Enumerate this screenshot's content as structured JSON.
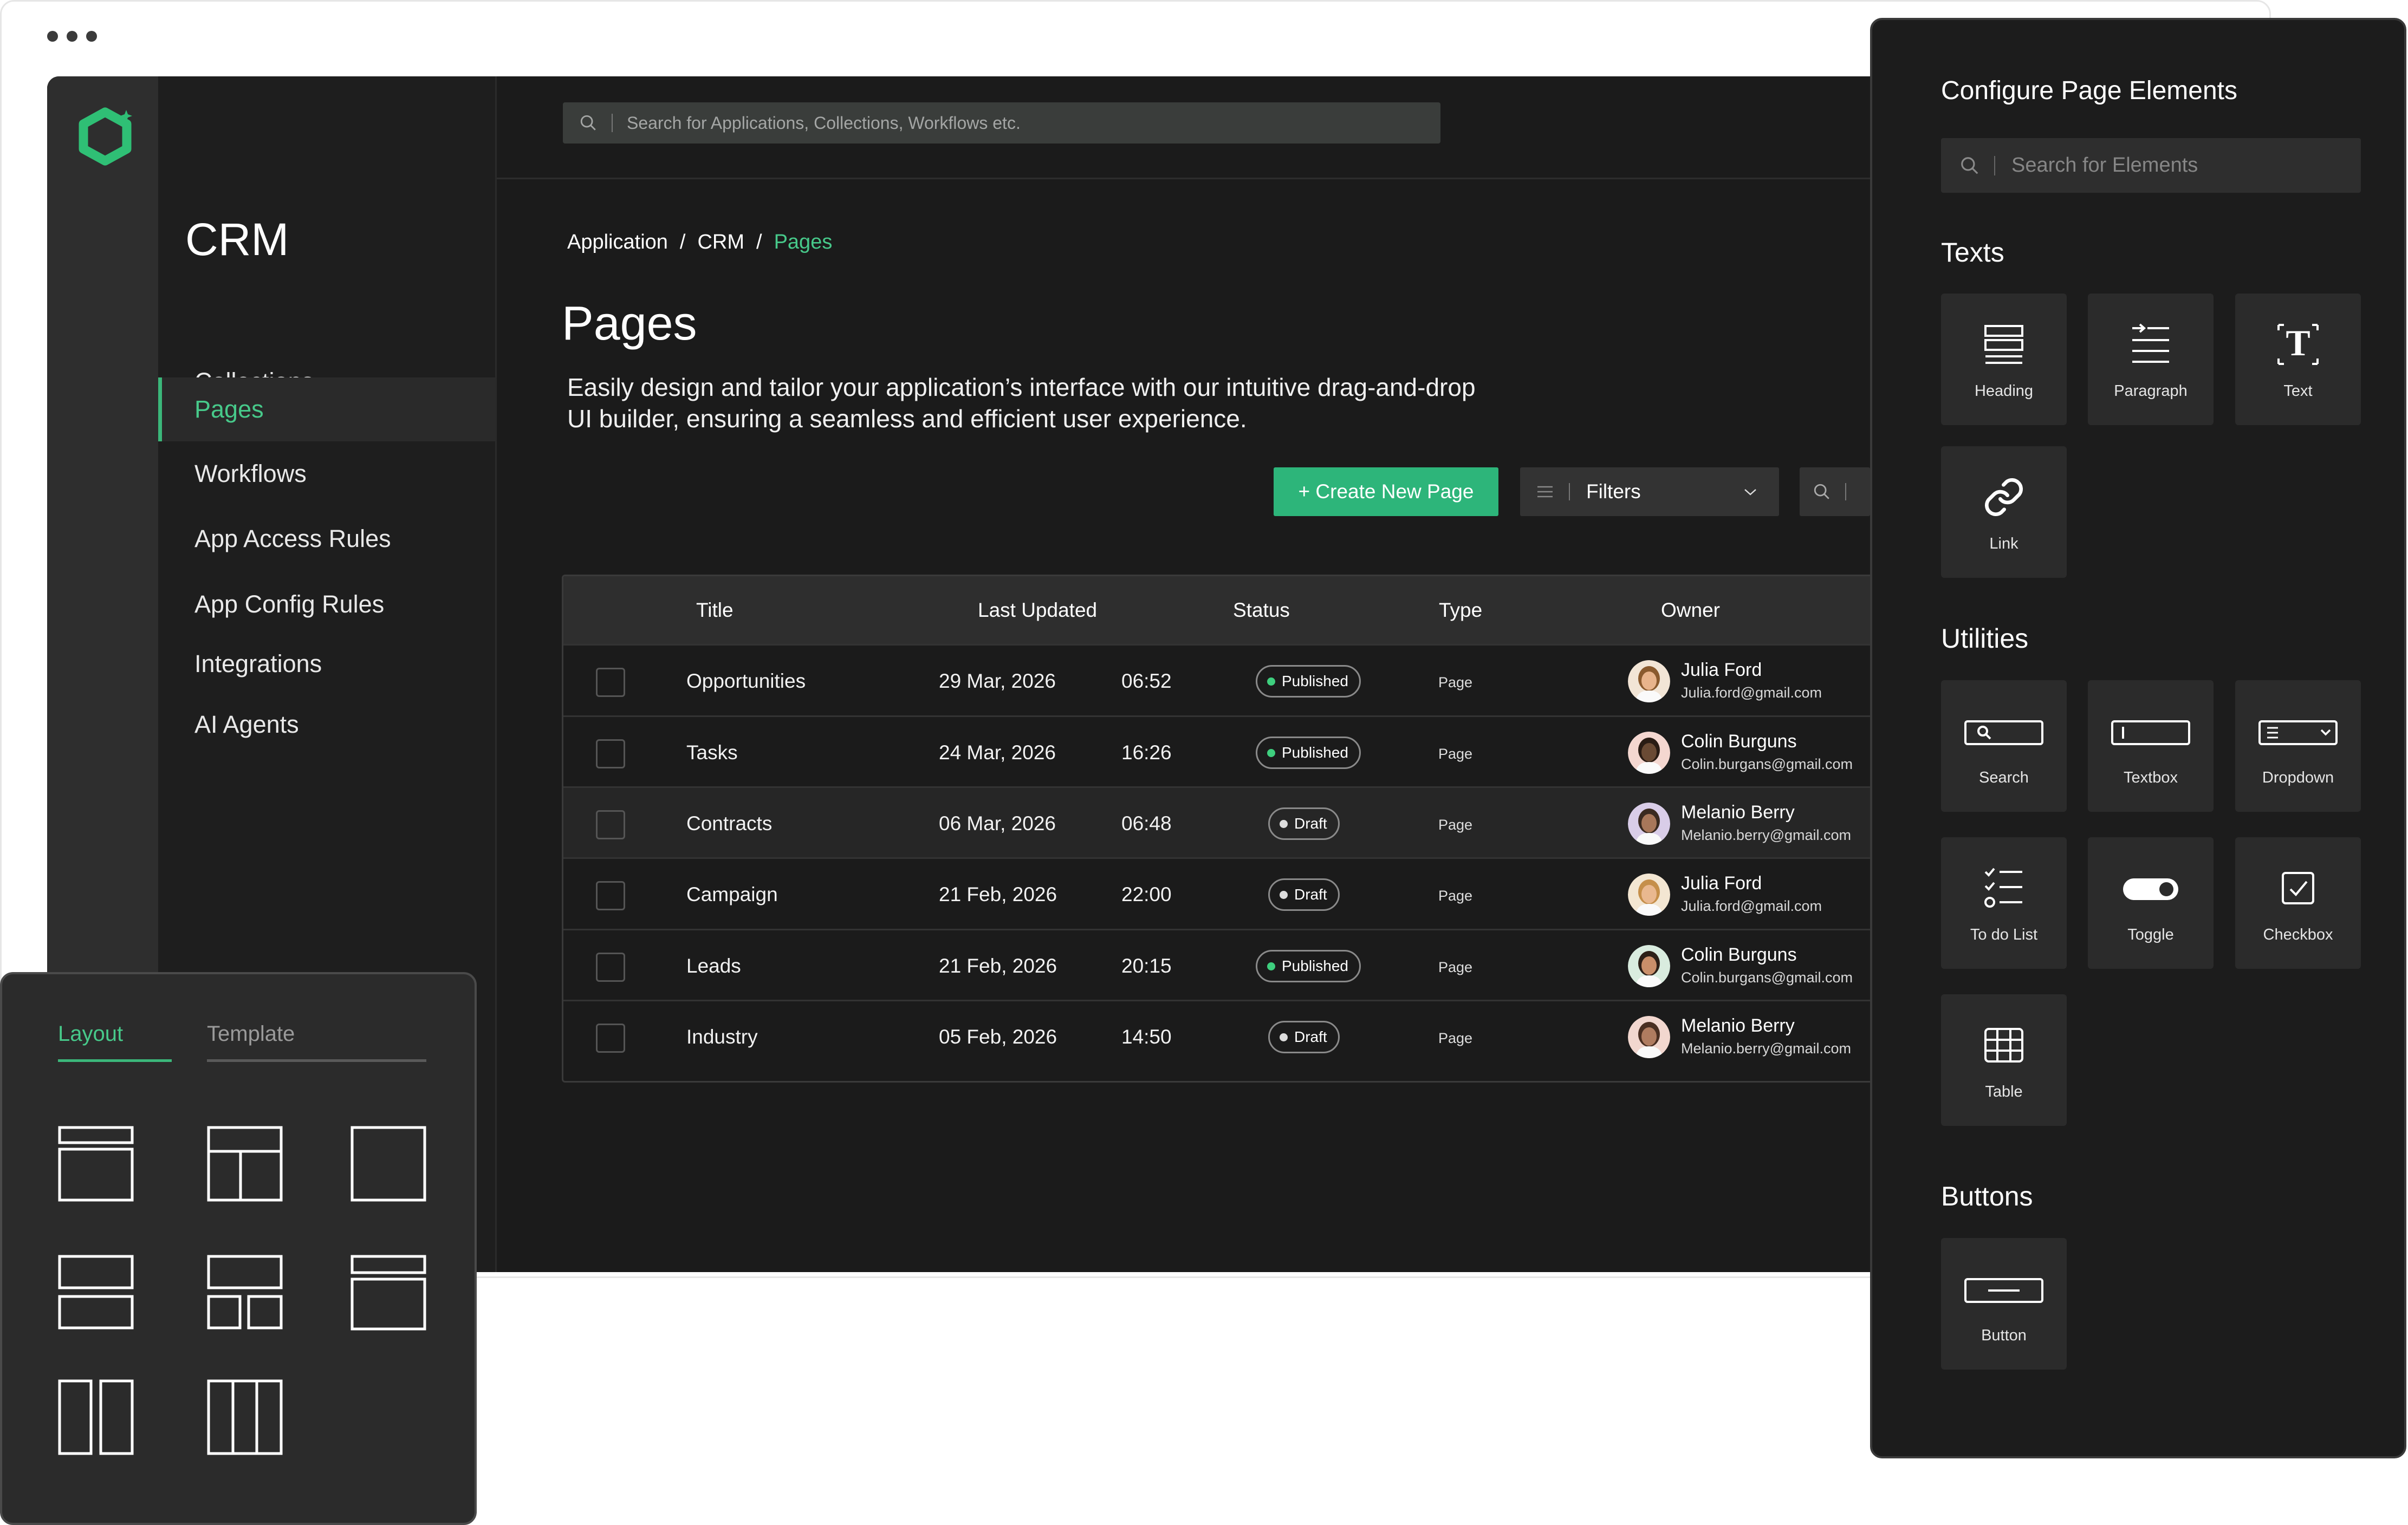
{
  "app": {
    "title": "CRM",
    "search_placeholder": "Search for Applications, Collections, Workflows etc."
  },
  "sidebar": {
    "items": [
      {
        "label": "Collections",
        "active": false
      },
      {
        "label": "Pages",
        "active": true
      },
      {
        "label": "Workflows",
        "active": false
      },
      {
        "label": "App Access Rules",
        "active": false
      },
      {
        "label": "App Config Rules",
        "active": false
      },
      {
        "label": "Integrations",
        "active": false
      },
      {
        "label": "AI Agents",
        "active": false
      }
    ]
  },
  "breadcrumb": {
    "items": [
      "Application",
      "CRM",
      "Pages"
    ],
    "separator": "/"
  },
  "page": {
    "title": "Pages",
    "description": "Easily design and tailor your application’s interface with our intuitive drag-and-drop UI builder, ensuring a seamless and efficient user experience."
  },
  "toolbar": {
    "create_label": "+  Create New Page",
    "filters_label": "Filters"
  },
  "table": {
    "headers": [
      "Title",
      "Last Updated",
      "Status",
      "Type",
      "Owner"
    ],
    "rows": [
      {
        "title": "Opportunities",
        "date": "29 Mar, 2026",
        "time": "06:52",
        "status": "Published",
        "type": "Page",
        "owner_name": "Julia Ford",
        "owner_email": "Julia.ford@gmail.com"
      },
      {
        "title": "Tasks",
        "date": "24 Mar, 2026",
        "time": "16:26",
        "status": "Published",
        "type": "Page",
        "owner_name": "Colin Burguns",
        "owner_email": "Colin.burgans@gmail.com"
      },
      {
        "title": "Contracts",
        "date": "06 Mar, 2026",
        "time": "06:48",
        "status": "Draft",
        "type": "Page",
        "owner_name": "Melanio Berry",
        "owner_email": "Melanio.berry@gmail.com"
      },
      {
        "title": "Campaign",
        "date": "21 Feb, 2026",
        "time": "22:00",
        "status": "Draft",
        "type": "Page",
        "owner_name": "Julia Ford",
        "owner_email": "Julia.ford@gmail.com"
      },
      {
        "title": "Leads",
        "date": "21 Feb, 2026",
        "time": "20:15",
        "status": "Published",
        "type": "Page",
        "owner_name": "Colin Burguns",
        "owner_email": "Colin.burgans@gmail.com"
      },
      {
        "title": "Industry",
        "date": "05 Feb, 2026",
        "time": "14:50",
        "status": "Draft",
        "type": "Page",
        "owner_name": "Melanio Berry",
        "owner_email": "Melanio.berry@gmail.com"
      }
    ]
  },
  "elements_panel": {
    "title": "Configure Page Elements",
    "search_placeholder": "Search for Elements",
    "sections": {
      "texts": {
        "label": "Texts",
        "items": [
          "Heading",
          "Paragraph",
          "Text",
          "Link"
        ]
      },
      "utilities": {
        "label": "Utilities",
        "items": [
          "Search",
          "Textbox",
          "Dropdown",
          "To do List",
          "Toggle",
          "Checkbox",
          "Table"
        ]
      },
      "buttons": {
        "label": "Buttons",
        "items": [
          "Button"
        ]
      }
    }
  },
  "layout_panel": {
    "tabs": [
      "Layout",
      "Template"
    ],
    "active_tab": "Layout"
  },
  "colors": {
    "accent": "#2db57a",
    "accent_text": "#47c98a",
    "background": "#1b1b1b",
    "published_dot": "#3ecf7e",
    "draft_dot": "#dddddd"
  }
}
